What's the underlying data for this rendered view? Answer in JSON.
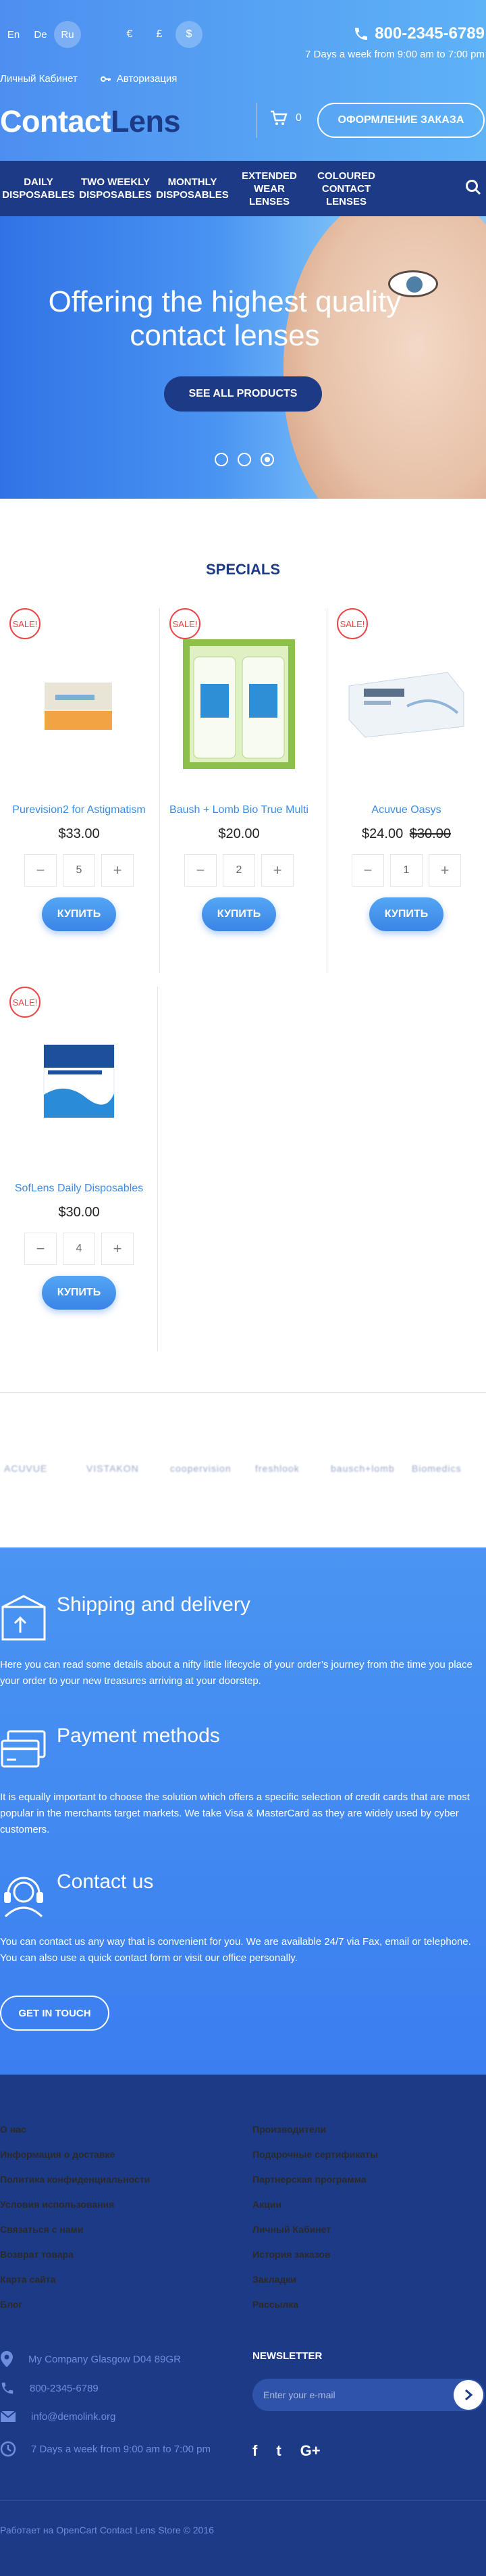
{
  "header": {
    "languages": [
      "En",
      "De",
      "Ru"
    ],
    "currencies": [
      "€",
      "£",
      "$"
    ],
    "phone": "800-2345-6789",
    "hours": "7 Days a week from 9:00 am to 7:00 pm",
    "account_link": "Личный Кабинет",
    "login_link": "Авторизация",
    "logo_part1": "Contact",
    "logo_part2": "Lens",
    "cart_count": "0",
    "checkout_label": "ОФОРМЛЕНИЕ ЗАКАЗА"
  },
  "nav": {
    "items": [
      [
        "DAILY",
        "DISPOSABLES"
      ],
      [
        "TWO WEEKLY",
        "DISPOSABLES"
      ],
      [
        "MONTHLY",
        "DISPOSABLES"
      ],
      [
        "EXTENDED",
        "WEAR",
        "LENSES"
      ],
      [
        "COLOURED",
        "CONTACT",
        "LENSES"
      ]
    ]
  },
  "hero": {
    "line1": "Offering the highest quality",
    "line2": "contact lenses",
    "button": "SEE ALL PRODUCTS"
  },
  "specials": {
    "title": "SPECIALS",
    "sale_label": "SALE!",
    "buy_label": "КУПИТЬ",
    "products": [
      {
        "name": "Purevision2 for Astigmatism",
        "price": "$33.00",
        "old_price": "",
        "qty": "5"
      },
      {
        "name": "Baush + Lomb Bio True Multi",
        "price": "$20.00",
        "old_price": "",
        "qty": "2"
      },
      {
        "name": "Acuvue Oasys",
        "price": "$24.00",
        "old_price": "$30.00",
        "qty": "1"
      },
      {
        "name": "SofLens Daily Disposables",
        "price": "$30.00",
        "old_price": "",
        "qty": "4"
      }
    ]
  },
  "brands": [
    "ACUVUE",
    "VISTAKON",
    "coopervision",
    "freshlook",
    "bausch+lomb",
    "Biomedics"
  ],
  "info": {
    "shipping_title": "Shipping and delivery",
    "shipping_text": "Here you can read some details about a nifty little lifecycle of your order’s journey from the time you place your order to your new treasures arriving at your doorstep.",
    "payment_title": "Payment methods",
    "payment_text": "It is equally important to choose the solution which offers a specific selection of credit cards that are most popular in the merchants target markets. We take Visa & MasterCard as they are widely used by cyber customers.",
    "contact_title": "Contact us",
    "contact_text": "You can contact us any way that is convenient for you. We are available 24/7 via Fax, email or telephone. You can also use a quick contact form or visit our office personally.",
    "button": "GET IN TOUCH"
  },
  "footer": {
    "col1": [
      "О нас",
      "Информация о доставке",
      "Политика конфиденциальности",
      "Условия использования",
      "Связаться с нами",
      "Возврат товара",
      "Карта сайта",
      "Блог"
    ],
    "col2": [
      "Производители",
      "Подарочные сертификаты",
      "Партнерская программа",
      "Акции",
      "Личный Кабинет",
      "История заказов",
      "Закладки",
      "Рассылка"
    ],
    "address": "My Company Glasgow D04 89GR",
    "phone": "800-2345-6789",
    "email": "info@demolink.org",
    "hours": "7 Days a week from 9:00 am to 7:00 pm",
    "newsletter_title": "NEWSLETTER",
    "newsletter_placeholder": "Enter your e-mail",
    "social": [
      "f",
      "t",
      "G+"
    ],
    "copyright": "Работает на OpenCart Contact Lens Store © 2016"
  },
  "colors": {
    "primary": "#1c3a86",
    "accent": "#4a95f2",
    "sale": "#e44444"
  }
}
